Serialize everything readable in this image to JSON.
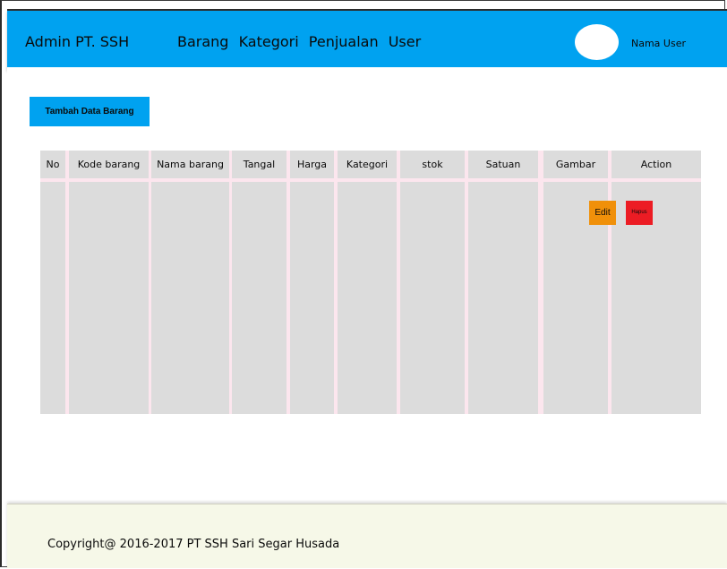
{
  "header": {
    "brand": "Admin PT. SSH",
    "nav": [
      "Barang",
      "Kategori",
      "Penjualan",
      "User"
    ],
    "user_name": "Nama User"
  },
  "main": {
    "add_button": "Tambah Data Barang",
    "table": {
      "columns": [
        "No",
        "Kode barang",
        "Nama barang",
        "Tangal",
        "Harga",
        "Kategori",
        "stok",
        "Satuan",
        "Gambar",
        "Action"
      ],
      "actions": {
        "edit": "Edit",
        "delete": "Hapus"
      }
    }
  },
  "footer": {
    "copyright": "Copyright@ 2016-2017 PT SSH Sari Segar Husada"
  },
  "colors": {
    "header_bg": "#00a2f0",
    "table_bg": "#dcdcdc",
    "edit": "#f0900a",
    "delete": "#ec1c24",
    "footer_bg": "#f6f8e8"
  }
}
